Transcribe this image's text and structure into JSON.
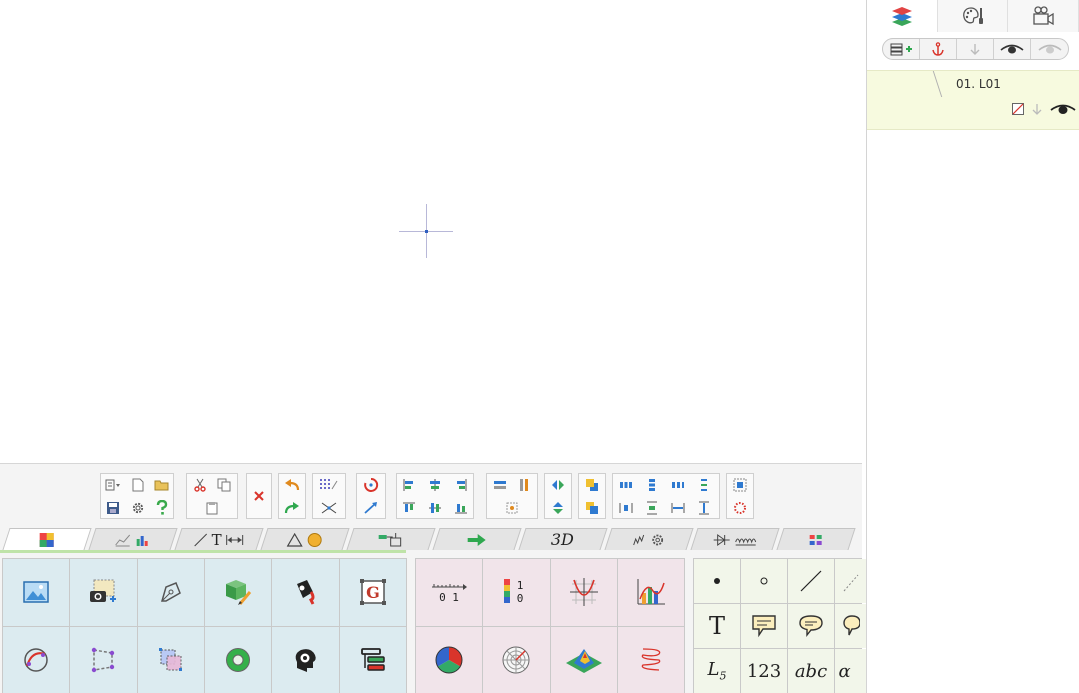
{
  "layers_panel": {
    "layer_name": "01. L01"
  },
  "palette_tabs": {
    "text_tab_glyph": "T",
    "threed_label": "3D"
  },
  "tools_grid": {
    "text_tool": "T",
    "label_tool": "L",
    "label_sub": "5",
    "number_tool": "123",
    "abc_tool": "abc",
    "alpha_tool": "α",
    "color_scale_hi": "1",
    "color_scale_lo": "0",
    "axis_ticks_label": "0 1"
  },
  "colors": {
    "accent_green": "#2fa84f",
    "accent_red": "#d9342b",
    "layer_row_bg": "#f7fadf",
    "tool_tile_blue": "#dcebf0",
    "tool_tile_pink": "#f1e4ea",
    "tool_tile_green": "#f2f6ea"
  }
}
